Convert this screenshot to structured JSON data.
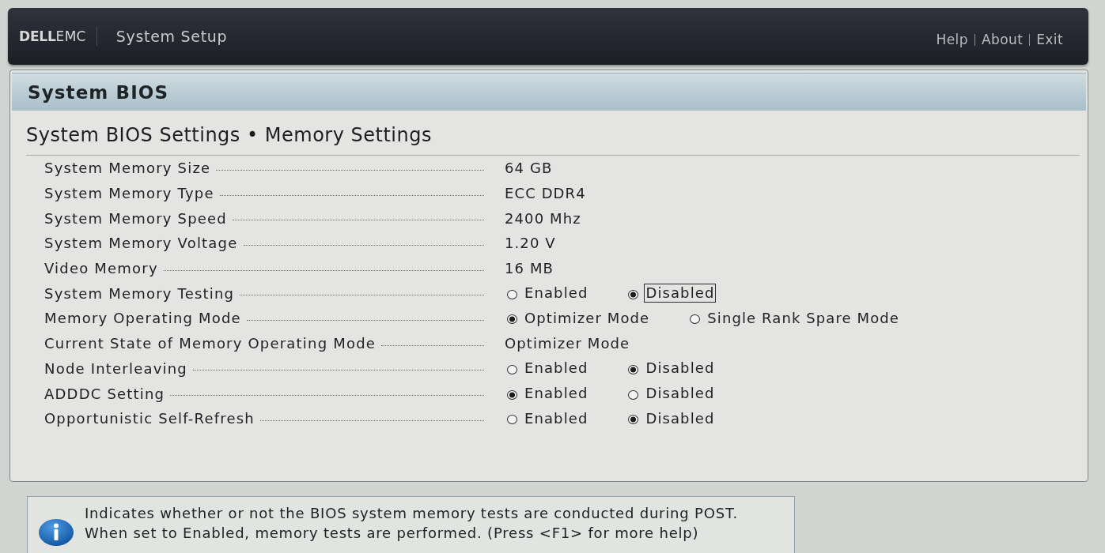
{
  "header": {
    "logo": [
      {
        "text": "DELL",
        "kind": "mark"
      },
      {
        "text": "EMC",
        "kind": "wordmark"
      }
    ],
    "title": "System Setup",
    "links": [
      {
        "label": "Help"
      },
      {
        "label": "About"
      },
      {
        "label": "Exit"
      }
    ]
  },
  "panel": {
    "title": "System BIOS",
    "heading": "System BIOS Settings • Memory Settings"
  },
  "settings": [
    {
      "label": "System Memory Size",
      "kind": "value",
      "value": "64 GB"
    },
    {
      "label": "System Memory Type",
      "kind": "value",
      "value": "ECC DDR4"
    },
    {
      "label": "System Memory Speed",
      "kind": "value",
      "value": "2400 Mhz"
    },
    {
      "label": "System Memory Voltage",
      "kind": "value",
      "value": "1.20 V"
    },
    {
      "label": "Video Memory",
      "kind": "value",
      "value": "16 MB"
    },
    {
      "label": "System Memory Testing",
      "kind": "radio",
      "options": [
        {
          "label": "Enabled",
          "selected": false,
          "focused": false
        },
        {
          "label": "Disabled",
          "selected": true,
          "focused": true
        }
      ]
    },
    {
      "label": "Memory Operating Mode",
      "kind": "radio",
      "options": [
        {
          "label": "Optimizer Mode",
          "selected": true,
          "focused": false
        },
        {
          "label": "Single Rank Spare Mode",
          "selected": false,
          "focused": false
        }
      ]
    },
    {
      "label": "Current State of Memory Operating Mode",
      "kind": "value",
      "value": "Optimizer Mode"
    },
    {
      "label": "Node Interleaving",
      "kind": "radio",
      "options": [
        {
          "label": "Enabled",
          "selected": false,
          "focused": false
        },
        {
          "label": "Disabled",
          "selected": true,
          "focused": false
        }
      ]
    },
    {
      "label": "ADDDC Setting",
      "kind": "radio",
      "options": [
        {
          "label": "Enabled",
          "selected": true,
          "focused": false
        },
        {
          "label": "Disabled",
          "selected": false,
          "focused": false
        }
      ]
    },
    {
      "label": "Opportunistic Self-Refresh",
      "kind": "radio",
      "options": [
        {
          "label": "Enabled",
          "selected": false,
          "focused": false
        },
        {
          "label": "Disabled",
          "selected": true,
          "focused": false
        }
      ]
    }
  ],
  "help": {
    "lines": [
      "Indicates whether or not the BIOS system memory tests are conducted during POST.",
      "When set to Enabled, memory tests are performed. (Press <F1> for more help)"
    ]
  }
}
